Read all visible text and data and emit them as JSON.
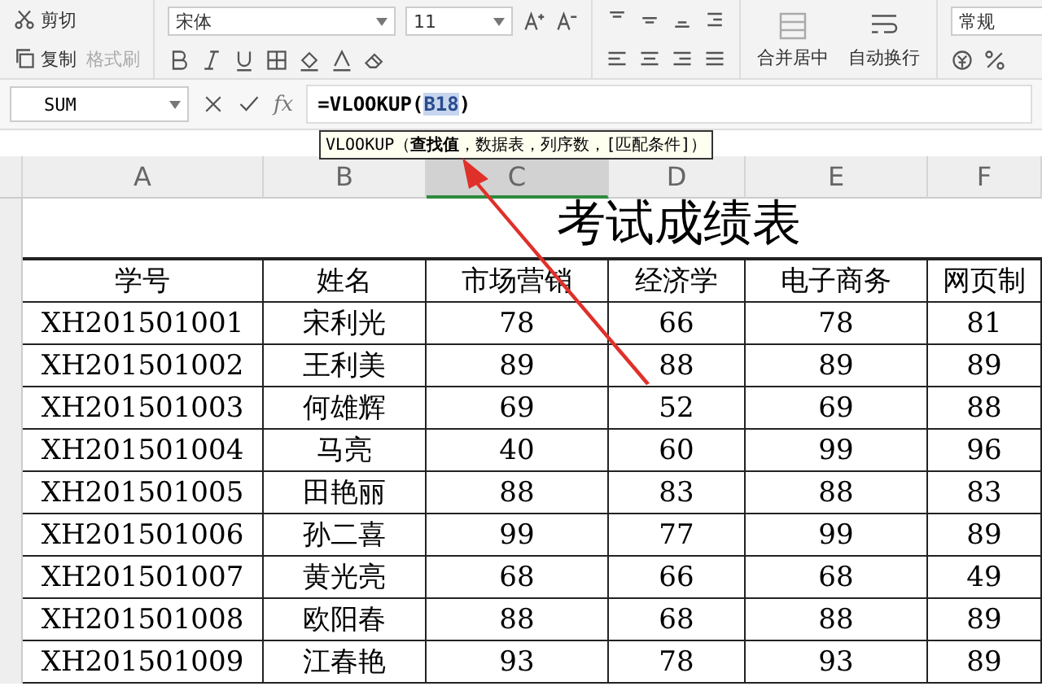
{
  "ribbon": {
    "clipboard": {
      "cut": "剪切",
      "copy": "复制",
      "format_painter": "格式刷"
    },
    "font": {
      "name": "宋体",
      "size": "11"
    },
    "merge": "合并居中",
    "wrap": "自动换行",
    "number_format": "常规"
  },
  "formula_bar": {
    "name_box": "SUM",
    "fx": "fx",
    "formula": {
      "before": "=VLOOKUP(",
      "reference": "B18",
      "after": ")"
    }
  },
  "tooltip": "VLOOKUP（**查找值**，数据表，列序数，[匹配条件]）",
  "columns": [
    {
      "label": "A",
      "selected": false
    },
    {
      "label": "B",
      "selected": false
    },
    {
      "label": "C",
      "selected": true
    },
    {
      "label": "D",
      "selected": false
    },
    {
      "label": "E",
      "selected": false
    },
    {
      "label": "F",
      "selected": false
    }
  ],
  "sheet": {
    "title": "考试成绩表",
    "headers": [
      "学号",
      "姓名",
      "市场营销",
      "经济学",
      "电子商务",
      "网页制"
    ],
    "rows": [
      [
        "XH201501001",
        "宋利光",
        "78",
        "66",
        "78",
        "81"
      ],
      [
        "XH201501002",
        "王利美",
        "89",
        "88",
        "89",
        "89"
      ],
      [
        "XH201501003",
        "何雄辉",
        "69",
        "52",
        "69",
        "88"
      ],
      [
        "XH201501004",
        "马亮",
        "40",
        "60",
        "99",
        "96"
      ],
      [
        "XH201501005",
        "田艳丽",
        "88",
        "83",
        "88",
        "83"
      ],
      [
        "XH201501006",
        "孙二喜",
        "99",
        "77",
        "99",
        "89"
      ],
      [
        "XH201501007",
        "黄光亮",
        "68",
        "66",
        "68",
        "49"
      ],
      [
        "XH201501008",
        "欧阳春",
        "88",
        "68",
        "88",
        "89"
      ],
      [
        "XH201501009",
        "江春艳",
        "93",
        "78",
        "93",
        "89"
      ]
    ]
  }
}
